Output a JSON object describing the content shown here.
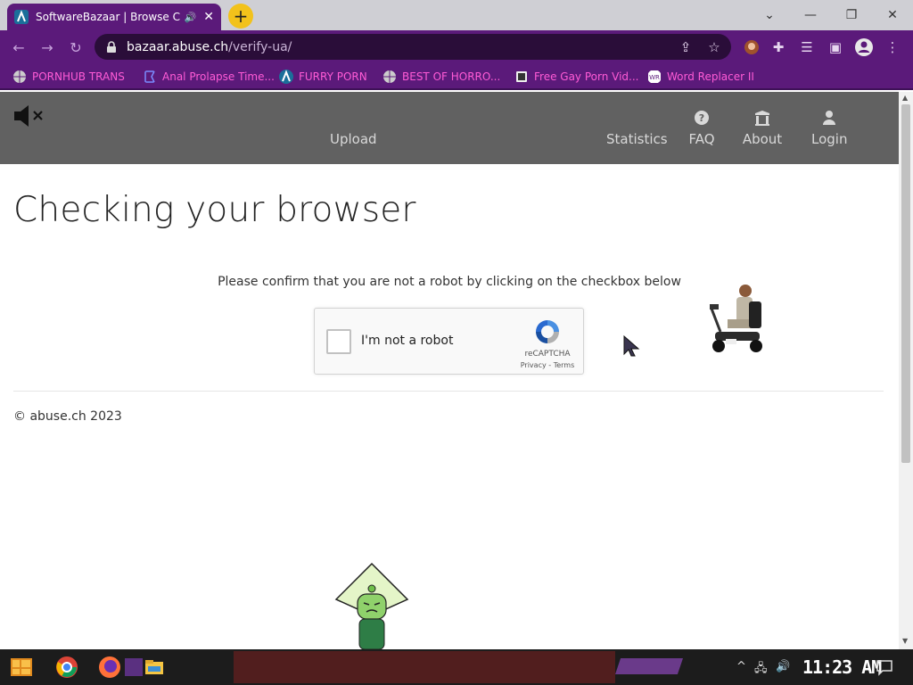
{
  "browser": {
    "tab": {
      "title": "SoftwareBazaar | Browse C",
      "audio_icon": "speaker-icon",
      "close_label": "✕"
    },
    "new_tab_label": "+",
    "window_controls": {
      "dropdown": "⌄",
      "minimize": "—",
      "restore": "❐",
      "close": "✕"
    },
    "nav": {
      "back": "←",
      "forward": "→",
      "reload": "↻"
    },
    "address": {
      "host": "bazaar.abuse.ch",
      "path": "/verify-ua/"
    },
    "toolbar_icons": [
      "share-icon",
      "star-icon",
      "extension-avatar-icon",
      "puzzle-icon",
      "reading-list-icon",
      "side-panel-icon",
      "profile-icon",
      "menu-icon"
    ],
    "bookmarks": [
      {
        "label": "PORNHUB TRANS",
        "icon": "globe-icon"
      },
      {
        "label": "Anal Prolapse Time...",
        "icon": "bookmark-flag-icon"
      },
      {
        "label": "FURRY PORN",
        "icon": "lambda-icon"
      },
      {
        "label": "BEST OF HORRO...",
        "icon": "globe-icon"
      },
      {
        "label": "Free Gay Porn Vid...",
        "icon": "site-icon"
      },
      {
        "label": "Word Replacer II",
        "icon": "wr-icon"
      }
    ]
  },
  "site": {
    "nav": {
      "upload": "Upload",
      "statistics": "Statistics",
      "faq": "FAQ",
      "about": "About",
      "login": "Login"
    },
    "heading": "Checking your browser",
    "prompt": "Please confirm that you are not a robot by clicking on the checkbox below",
    "captcha": {
      "label": "I'm not a robot",
      "brand": "reCAPTCHA",
      "privacy": "Privacy",
      "separator": " - ",
      "terms": "Terms"
    },
    "footer": "© abuse.ch 2023"
  },
  "taskbar": {
    "clock": "11:23 AM",
    "tray_up": "^"
  },
  "colors": {
    "browser_accent": "#5b1a7a",
    "site_nav": "#616161",
    "bookmark_text": "#ff5bd6",
    "new_tab": "#f2c21b"
  }
}
